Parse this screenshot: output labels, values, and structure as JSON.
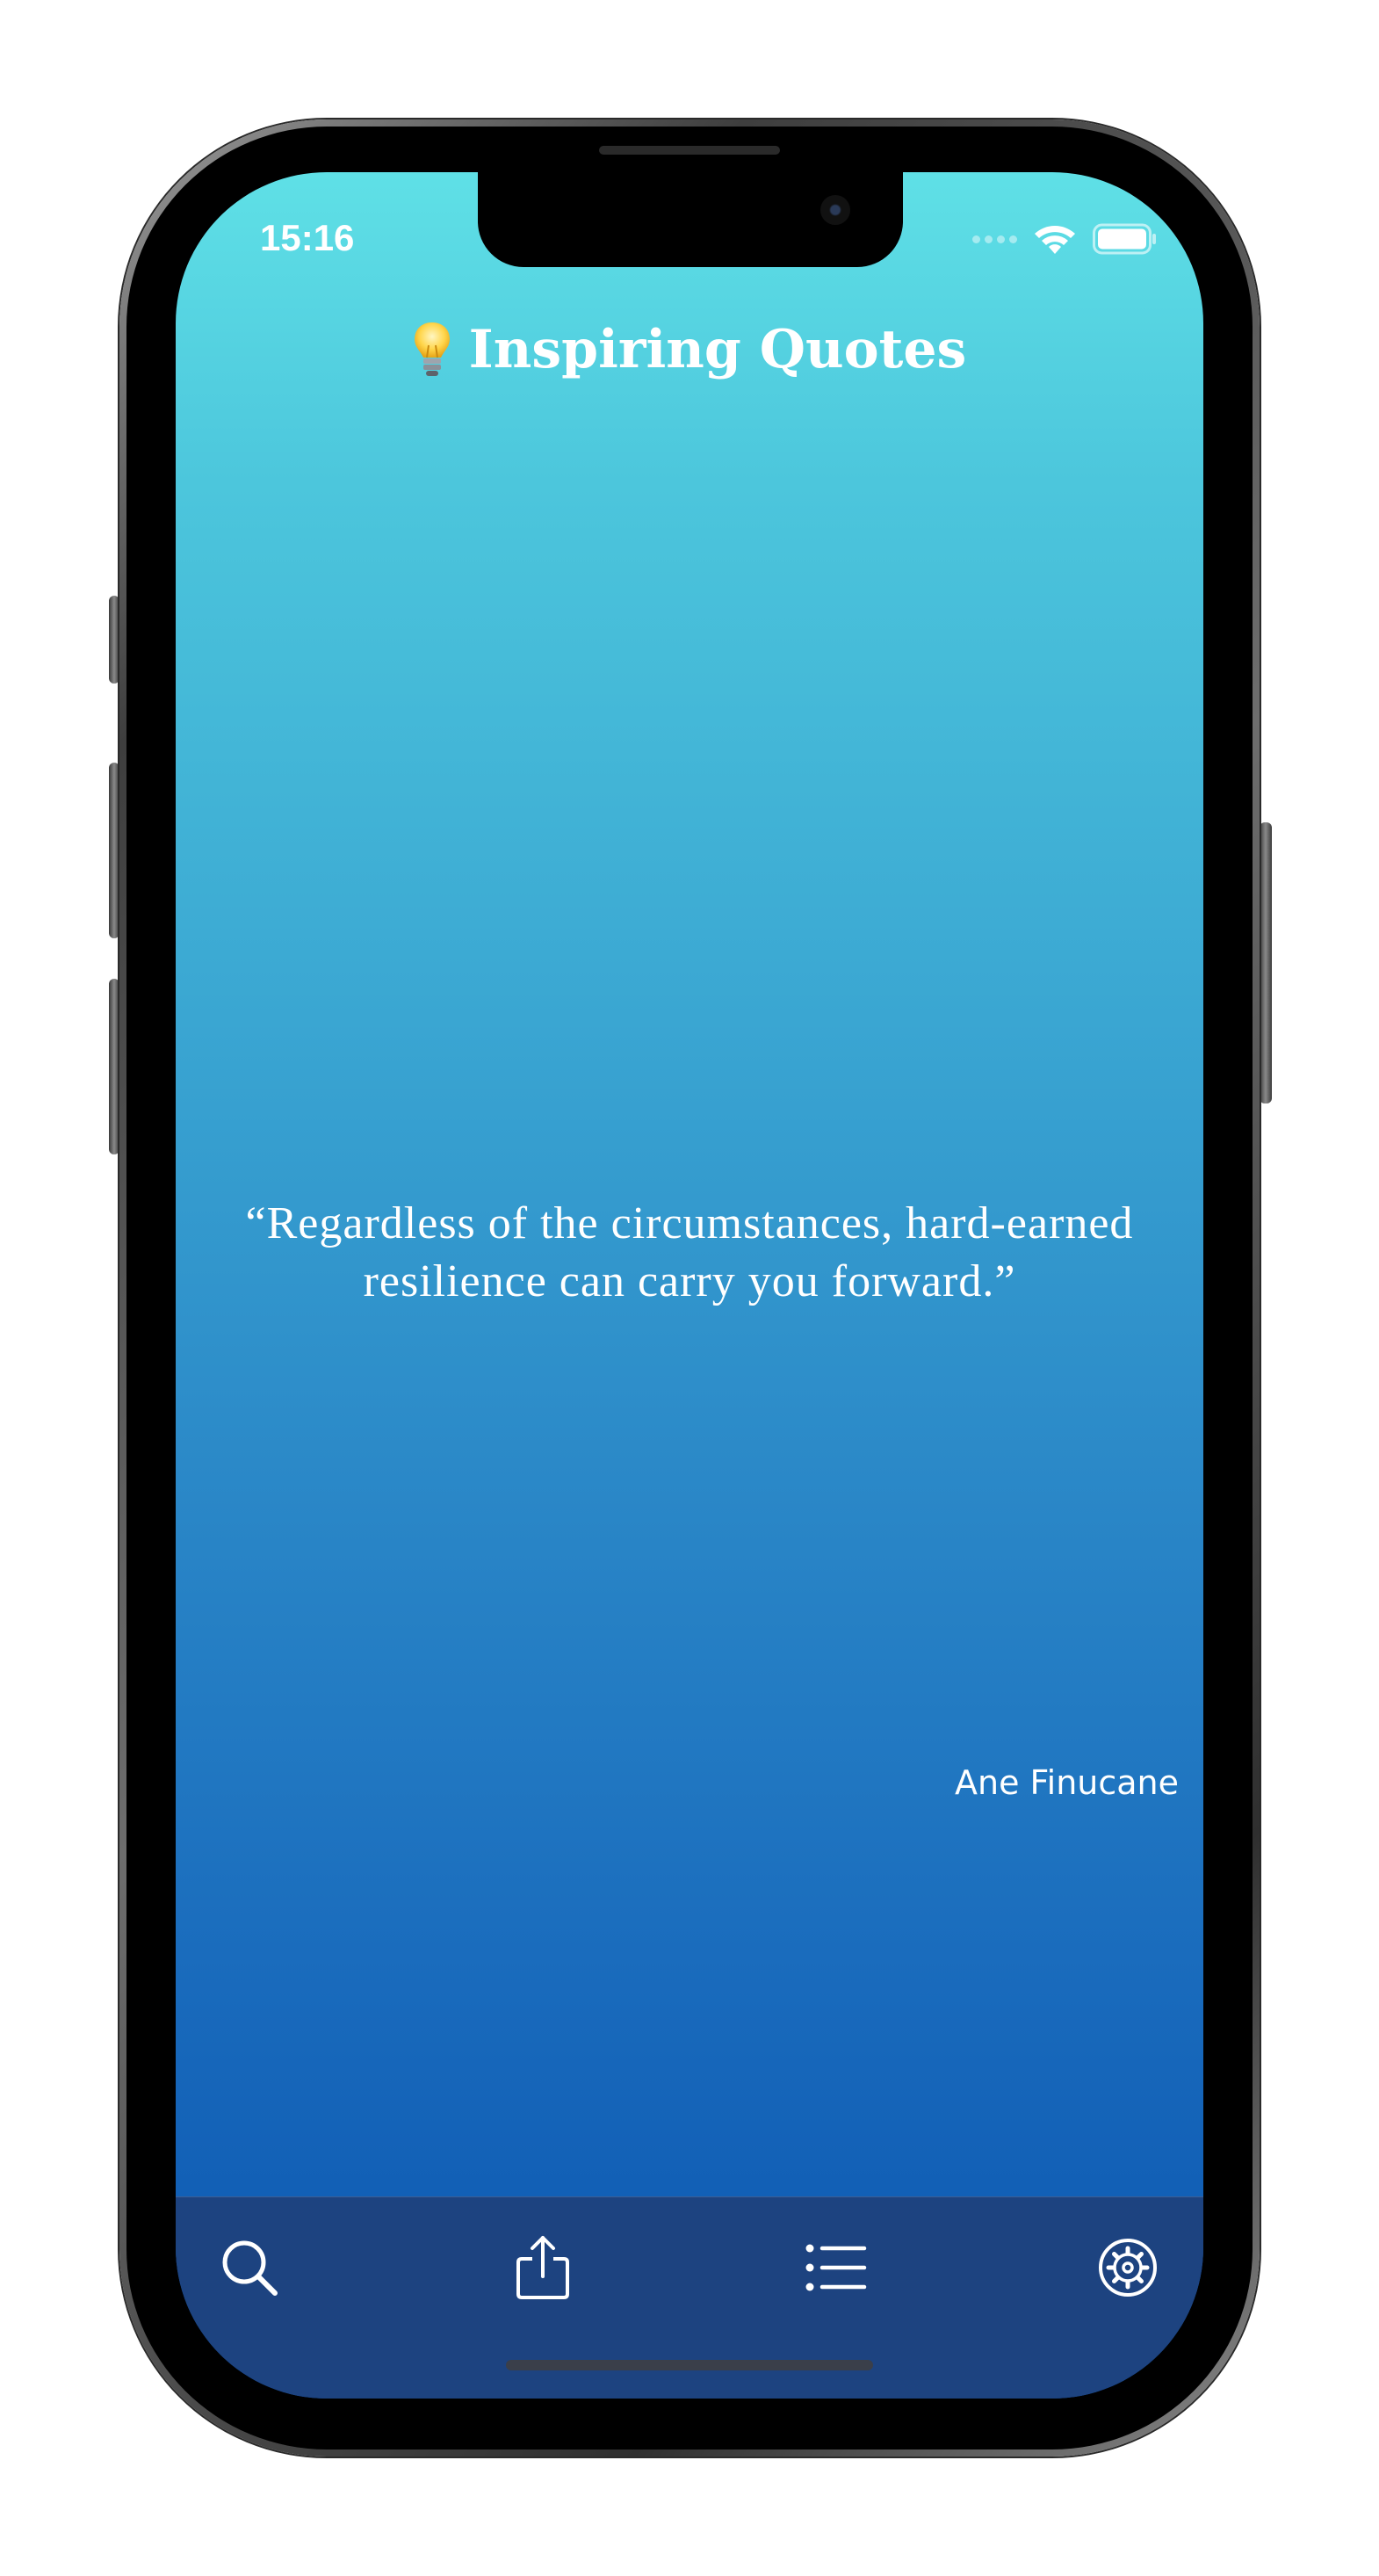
{
  "status_bar": {
    "time": "15:16",
    "signal_icon": "signal-dots-icon",
    "wifi_icon": "wifi-icon",
    "battery_icon": "battery-icon"
  },
  "header": {
    "icon": "lightbulb-icon",
    "title": "Inspiring Quotes"
  },
  "quote": {
    "text": "“Regardless of the circumstances, hard-earned resilience can carry you forward.”",
    "author": "Ane Finucane"
  },
  "tab_bar": {
    "items": [
      {
        "icon": "search-icon"
      },
      {
        "icon": "share-icon"
      },
      {
        "icon": "list-icon"
      },
      {
        "icon": "settings-icon"
      }
    ]
  },
  "colors": {
    "gradient_top": "#5fe0e6",
    "gradient_bottom": "#0b55b0",
    "tab_bar_background": "#1d4380",
    "text": "#ffffff"
  }
}
